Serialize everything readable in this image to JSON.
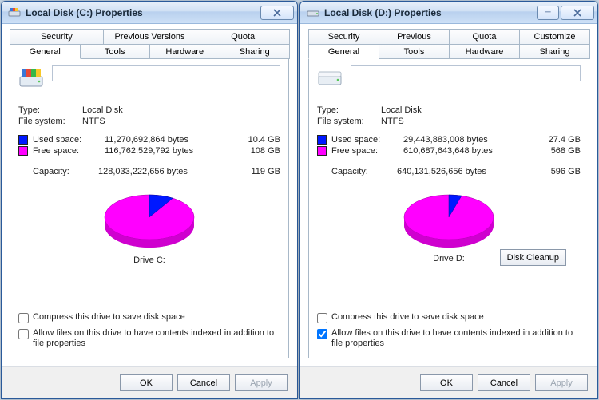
{
  "dialogs": [
    {
      "id": "c",
      "title": "Local Disk (C:) Properties",
      "tabs_row1": [
        "Security",
        "Previous Versions",
        "Quota"
      ],
      "tabs_row2": [
        "General",
        "Tools",
        "Hardware",
        "Sharing"
      ],
      "active_tab": "General",
      "type_label": "Type:",
      "type_value": "Local Disk",
      "fs_label": "File system:",
      "fs_value": "NTFS",
      "used_label": "Used space:",
      "used_bytes": "11,270,692,864 bytes",
      "used_gb": "10.4 GB",
      "free_label": "Free space:",
      "free_bytes": "116,762,529,792 bytes",
      "free_gb": "108 GB",
      "capacity_label": "Capacity:",
      "capacity_bytes": "128,033,222,656 bytes",
      "capacity_gb": "119 GB",
      "drive_label": "Drive C:",
      "show_disk_cleanup": false,
      "compress_label": "Compress this drive to save disk space",
      "compress_checked": false,
      "index_label": "Allow files on this drive to have contents indexed in addition to file properties",
      "index_checked": false,
      "used_pct": 8.8,
      "ok": "OK",
      "cancel": "Cancel",
      "apply": "Apply"
    },
    {
      "id": "d",
      "title": "Local Disk (D:) Properties",
      "tabs_row1": [
        "Security",
        "Previous Versions",
        "Quota",
        "Customize"
      ],
      "tabs_row2": [
        "General",
        "Tools",
        "Hardware",
        "Sharing"
      ],
      "active_tab": "General",
      "type_label": "Type:",
      "type_value": "Local Disk",
      "fs_label": "File system:",
      "fs_value": "NTFS",
      "used_label": "Used space:",
      "used_bytes": "29,443,883,008 bytes",
      "used_gb": "27.4 GB",
      "free_label": "Free space:",
      "free_bytes": "610,687,643,648 bytes",
      "free_gb": "568 GB",
      "capacity_label": "Capacity:",
      "capacity_bytes": "640,131,526,656 bytes",
      "capacity_gb": "596 GB",
      "drive_label": "Drive D:",
      "show_disk_cleanup": true,
      "disk_cleanup_label": "Disk Cleanup",
      "compress_label": "Compress this drive to save disk space",
      "compress_checked": false,
      "index_label": "Allow files on this drive to have contents indexed in addition to file properties",
      "index_checked": true,
      "used_pct": 4.6,
      "ok": "OK",
      "cancel": "Cancel",
      "apply": "Apply"
    }
  ],
  "chart_data": [
    {
      "type": "pie",
      "title": "Drive C: usage",
      "series": [
        {
          "name": "Used space",
          "value_bytes": 11270692864,
          "value_gb": 10.4,
          "color": "#0018ff"
        },
        {
          "name": "Free space",
          "value_bytes": 116762529792,
          "value_gb": 108,
          "color": "#ff00ff"
        }
      ],
      "total_bytes": 128033222656,
      "total_gb": 119
    },
    {
      "type": "pie",
      "title": "Drive D: usage",
      "series": [
        {
          "name": "Used space",
          "value_bytes": 29443883008,
          "value_gb": 27.4,
          "color": "#0018ff"
        },
        {
          "name": "Free space",
          "value_bytes": 610687643648,
          "value_gb": 568,
          "color": "#ff00ff"
        }
      ],
      "total_bytes": 640131526656,
      "total_gb": 596
    }
  ]
}
